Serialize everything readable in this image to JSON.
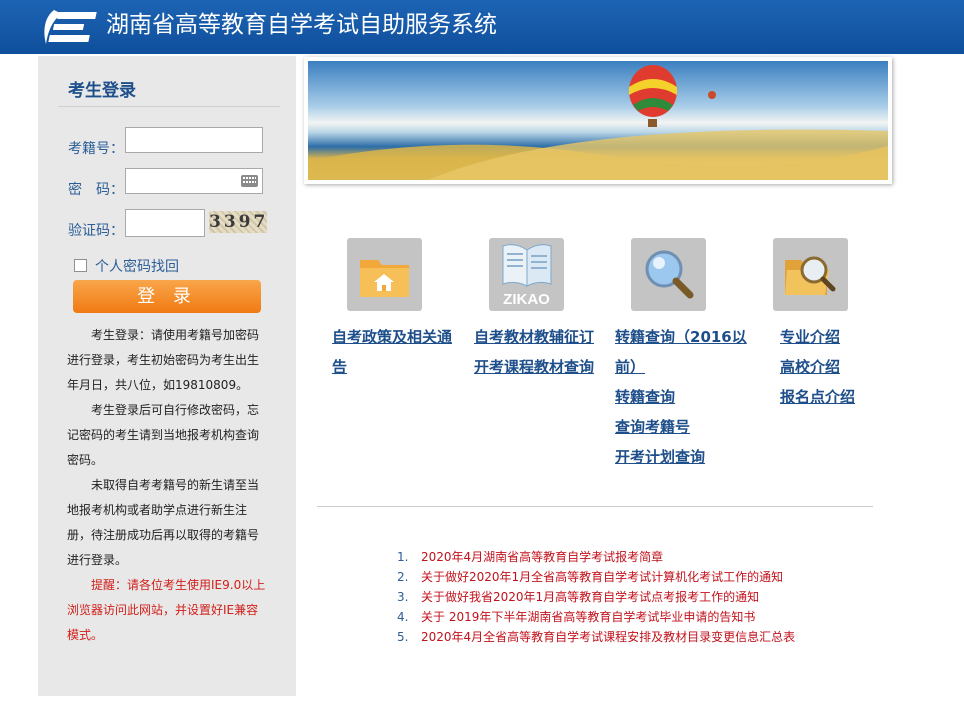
{
  "header": {
    "title": "湖南省高等教育自学考试自助服务系统",
    "logo": "e-logo-icon"
  },
  "login": {
    "heading": "考生登录",
    "id_label": "考籍号：",
    "id_value": "",
    "password_label": "密　码：",
    "password_value": "",
    "captcha_label": "验证码：",
    "captcha_value": "",
    "captcha_text": "3397",
    "recover_label": "个人密码找回",
    "login_button": "登 录",
    "notes": [
      "考生登录：请使用考籍号加密码进行登录，考生初始密码为考生出生年月日，共八位，如19810809。",
      "考生登录后可自行修改密码，忘记密码的考生请到当地报考机构查询密码。",
      "未取得自考考籍号的新生请至当地报考机构或者助学点进行新生注册，待注册成功后再以取得的考籍号进行登录。"
    ],
    "warning": "提醒：请各位考生使用IE9.0以上浏览器访问此网站，并设置好IE兼容模式。"
  },
  "tiles": [
    {
      "icon": "folder-home-icon",
      "tag": ""
    },
    {
      "icon": "book-zikao-icon",
      "tag": "ZIKAO"
    },
    {
      "icon": "magnifier-icon",
      "tag": ""
    },
    {
      "icon": "folder-search-icon",
      "tag": ""
    }
  ],
  "links": {
    "col1": [
      "自考政策及相关通",
      "告"
    ],
    "col2": [
      "自考教材教辅征订",
      "开考课程教材查询"
    ],
    "col3": [
      "转籍查询（2016以",
      "前）",
      "转籍查询",
      "查询考籍号",
      "开考计划查询"
    ],
    "col4": [
      "专业介绍",
      "高校介绍",
      "报名点介绍"
    ]
  },
  "news": [
    {
      "num": "1.",
      "text": "2020年4月湖南省高等教育自学考试报考简章"
    },
    {
      "num": "2.",
      "text": "关于做好2020年1月全省高等教育自学考试计算机化考试工作的通知"
    },
    {
      "num": "3.",
      "text": "关于做好我省2020年1月高等教育自学考试点考报考工作的通知"
    },
    {
      "num": "4.",
      "text": "关于 2019年下半年湖南省高等教育自学考试毕业申请的告知书"
    },
    {
      "num": "5.",
      "text": "2020年4月全省高等教育自学考试课程安排及教材目录变更信息汇总表"
    }
  ],
  "colors": {
    "header": "#1560b0",
    "accent_orange": "#f28a1f",
    "link": "#1e4f8a",
    "news": "#c1121c"
  }
}
